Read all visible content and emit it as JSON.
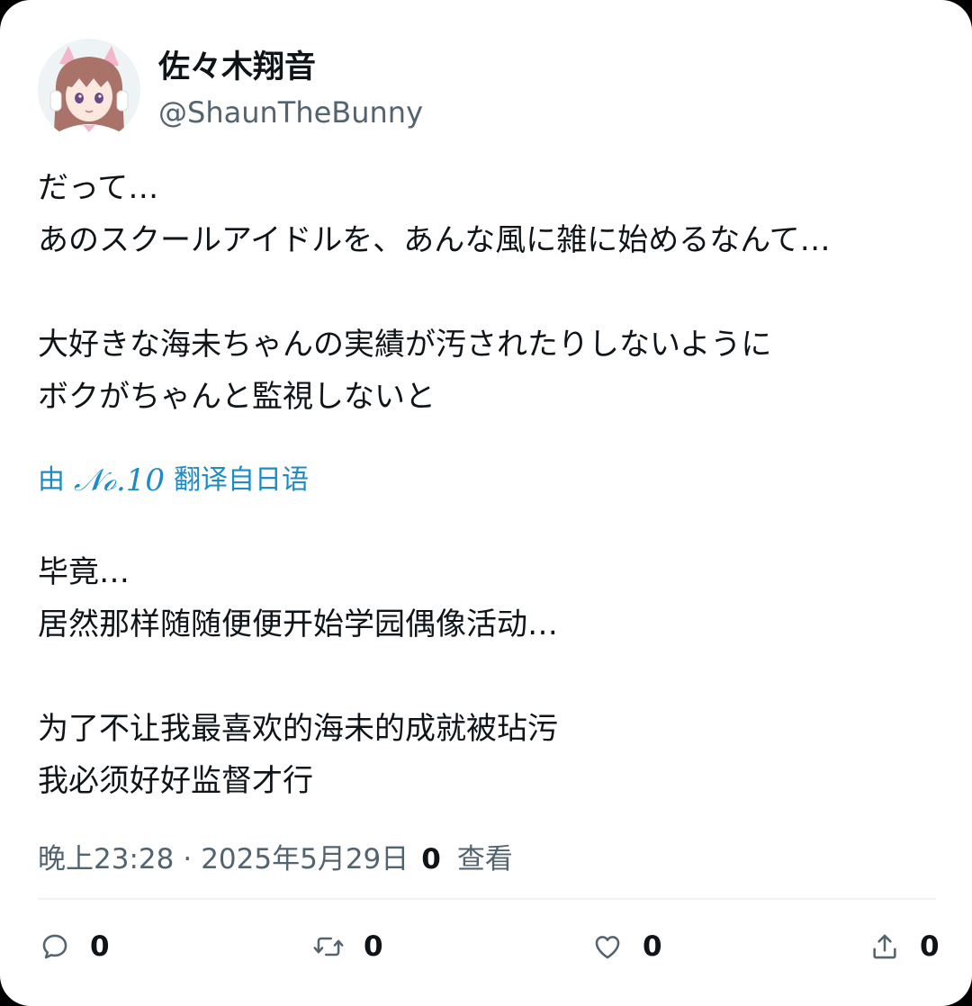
{
  "author": {
    "display_name": "佐々木翔音",
    "handle": "@ShaunTheBunny"
  },
  "tweet": {
    "original_text": "だって…\nあのスクールアイドルを、あんな風に雑に始めるなんて…\n\n大好きな海未ちゃんの実績が汚されたりしないように\nボクがちゃんと監視しないと",
    "translation_prefix": "由",
    "translation_model": "𝒩ℴ.10",
    "translation_suffix": "翻译自日语",
    "translated_text": "毕竟…\n居然那样随随便便开始学园偶像活动…\n\n为了不让我最喜欢的海未的成就被玷污\n我必须好好监督才行"
  },
  "meta": {
    "time": "晚上23:28",
    "separator": "·",
    "date": "2025年5月29日",
    "views_count": "0",
    "views_label": "查看"
  },
  "actions": {
    "reply_count": "0",
    "retweet_count": "0",
    "like_count": "0",
    "share_count": "0"
  },
  "icons": {
    "reply": "speech-bubble-icon",
    "retweet": "retweet-arrows-icon",
    "like": "heart-icon",
    "share": "share-upload-icon"
  },
  "colors": {
    "text_primary": "#0f1419",
    "text_secondary": "#536471",
    "translation_link": "#1d8bc6",
    "divider": "#eff3f4"
  }
}
